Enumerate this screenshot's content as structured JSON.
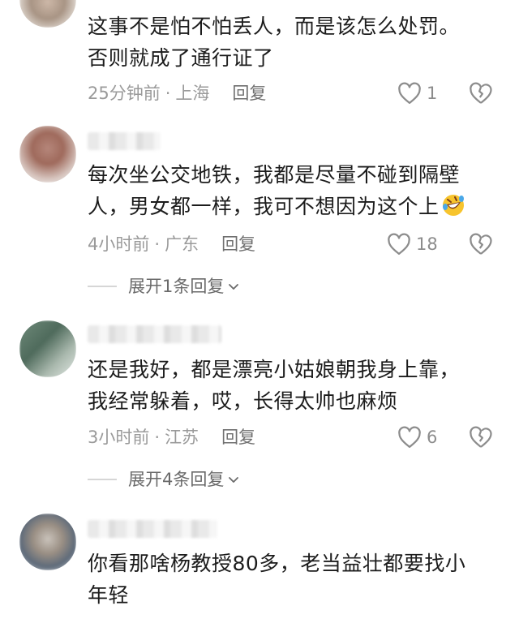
{
  "comments": [
    {
      "text_lines": [
        "这事不是怕不怕丢人，而是该怎么处罚。",
        "否则就成了通行证了"
      ],
      "time": "25分钟前",
      "location": "上海",
      "reply_label": "回复",
      "likes": "1"
    },
    {
      "text_lines": [
        "每次坐公交地铁，我都是尽量不碰到隔壁",
        "人，男女都一样，我可不想因为这个上"
      ],
      "emoji": "rofl-emoji",
      "time": "4小时前",
      "location": "广东",
      "reply_label": "回复",
      "likes": "18",
      "expand_label": "展开1条回复"
    },
    {
      "text_lines": [
        "还是我好，都是漂亮小姑娘朝我身上靠，",
        "我经常躲着，哎，长得太帅也麻烦"
      ],
      "time": "3小时前",
      "location": "江苏",
      "reply_label": "回复",
      "likes": "6",
      "expand_label": "展开4条回复"
    },
    {
      "text_lines": [
        "你看那啥杨教授80多，老当益壮都要找小",
        "年轻"
      ]
    }
  ],
  "separator": "·",
  "icons": {
    "like": "heart-outline-icon",
    "dislike": "broken-heart-icon",
    "expand": "chevron-down-icon"
  },
  "colors": {
    "text": "#1c1c1c",
    "meta": "#9a9a9a",
    "icon": "#8c8c8c"
  }
}
